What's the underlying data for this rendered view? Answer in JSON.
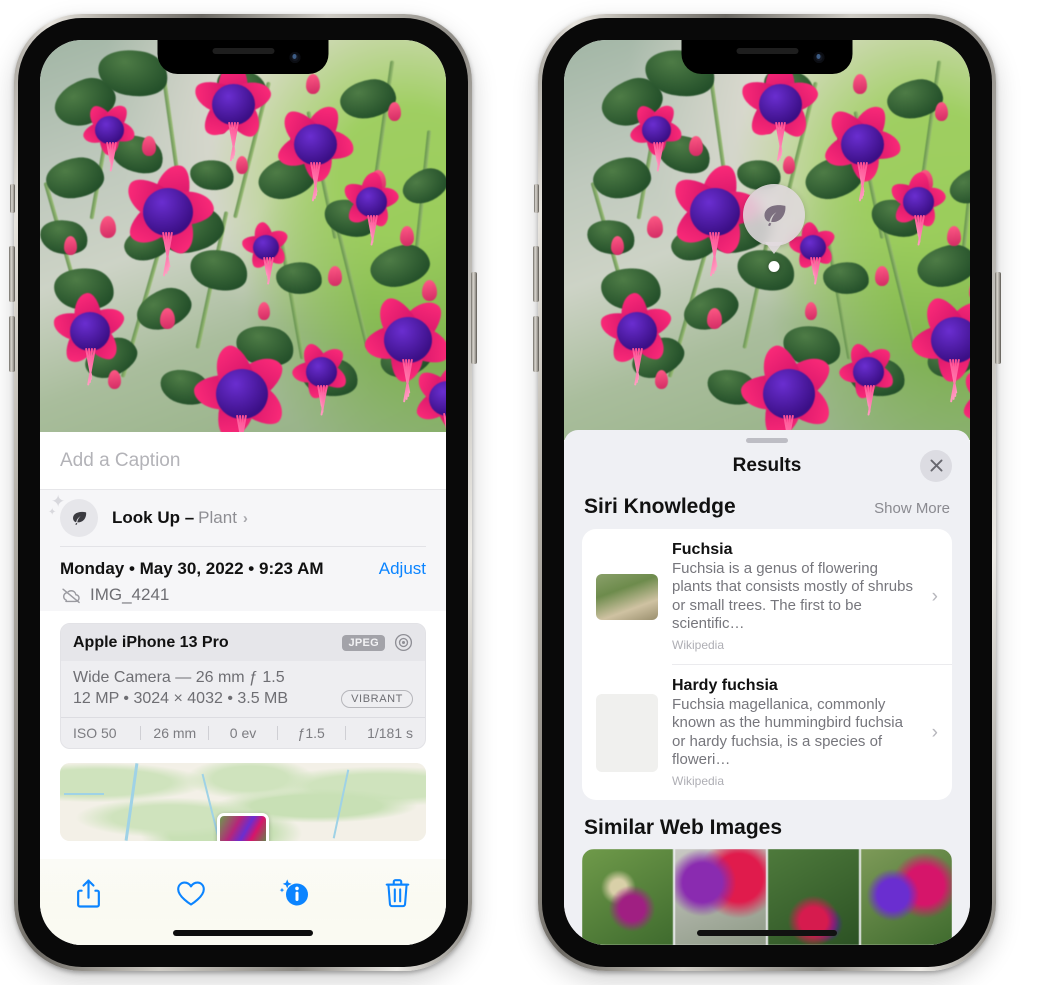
{
  "left_phone": {
    "photo": {
      "alt": "fuchsia-flowers-photo"
    },
    "caption_placeholder": "Add a Caption",
    "lookup": {
      "icon": "leaf-icon",
      "sparkle_icon": "sparkle-icon",
      "label": "Look Up –",
      "subject": "Plant",
      "chevron": "›"
    },
    "meta": {
      "date": "Monday • May 30, 2022 • 9:23 AM",
      "adjust_label": "Adjust",
      "cloud_icon": "cloud-slash-icon",
      "filename": "IMG_4241"
    },
    "exif": {
      "device": "Apple iPhone 13 Pro",
      "format_badge": "JPEG",
      "aperture_icon": "aperture-icon",
      "lens_line": "Wide Camera — 26 mm ƒ 1.5",
      "specs_line": "12 MP • 3024 × 4032 • 3.5 MB",
      "style_badge": "VIBRANT",
      "settings": [
        "ISO 50",
        "26 mm",
        "0 ev",
        "ƒ1.5",
        "1/181 s"
      ]
    },
    "map": {
      "pin_icon": "photo-pin"
    },
    "toolbar": [
      {
        "name": "share-button",
        "icon": "share-icon"
      },
      {
        "name": "favorite-button",
        "icon": "heart-icon"
      },
      {
        "name": "info-button",
        "icon": "info-sparkle-icon"
      },
      {
        "name": "delete-button",
        "icon": "trash-icon"
      }
    ],
    "accent_color": "#0b84ff"
  },
  "right_phone": {
    "badge": {
      "icon": "leaf-icon"
    },
    "sheet": {
      "title": "Results",
      "close_icon": "close-icon",
      "sections": [
        {
          "title": "Siri Knowledge",
          "action": "Show More",
          "items": [
            {
              "title": "Fuchsia",
              "description": "Fuchsia is a genus of flowering plants that consists mostly of shrubs or small trees. The first to be scientific…",
              "source": "Wikipedia",
              "chevron": "›"
            },
            {
              "title": "Hardy fuchsia",
              "description": "Fuchsia magellanica, commonly known as the hummingbird fuchsia or hardy fuchsia, is a species of floweri…",
              "source": "Wikipedia",
              "chevron": "›"
            }
          ]
        },
        {
          "title": "Similar Web Images",
          "images": [
            {
              "name": "web-image-1"
            },
            {
              "name": "web-image-2"
            },
            {
              "name": "web-image-3"
            },
            {
              "name": "web-image-4"
            }
          ]
        }
      ]
    }
  }
}
